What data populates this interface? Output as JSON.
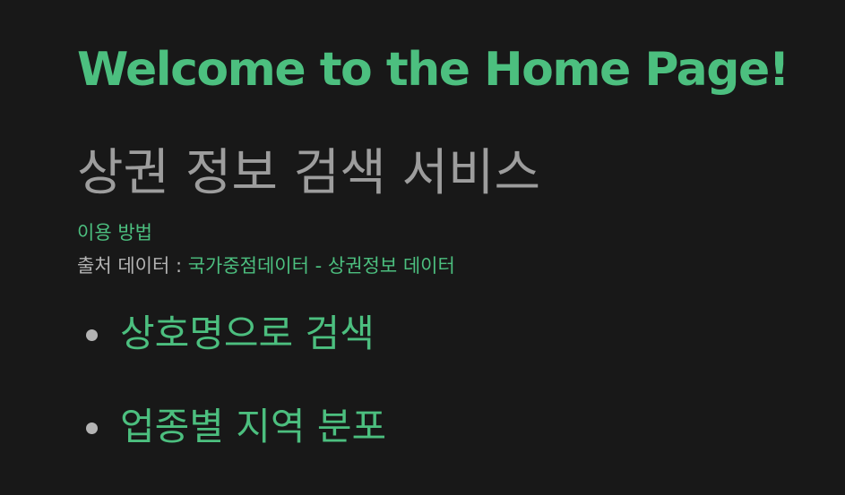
{
  "heading": {
    "welcome": "Welcome to the Home Page!",
    "service_title": "상권 정보 검색 서비스"
  },
  "info": {
    "usage_link": "이용 방법",
    "source_label": "출처 데이터 : ",
    "source_link": "국가중점데이터 - 상권정보 데이터"
  },
  "menu": {
    "items": [
      {
        "label": "상호명으로 검색"
      },
      {
        "label": "업종별 지역 분포"
      }
    ]
  },
  "colors": {
    "background": "#181818",
    "accent_green": "#4cbf7f",
    "muted_gray": "#9d9d9d",
    "text_gray": "#b4b4b4"
  }
}
